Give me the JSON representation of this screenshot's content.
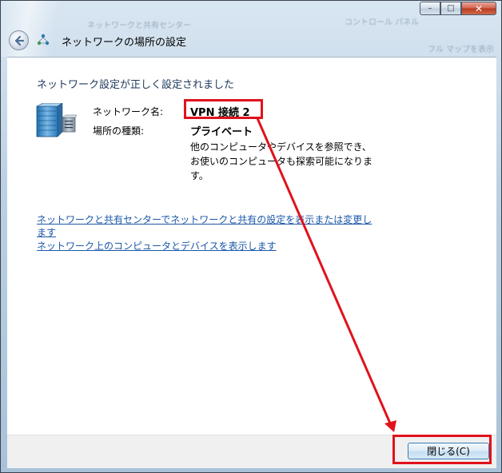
{
  "window": {
    "title_blur_1": "ネットワークと共有センター",
    "title_blur_2": "コントロール パネル",
    "title_blur_3": "フル マップを表示",
    "nav_title": "ネットワークの場所の設定",
    "controls": {
      "minimize": "–",
      "maximize": "□",
      "close": "✕"
    }
  },
  "content": {
    "heading": "ネットワーク設定が正しく設定されました",
    "network_name_label": "ネットワーク名:",
    "network_name_value": "VPN 接続 2",
    "location_type_label": "場所の種類:",
    "location_type_value": "プライベート",
    "description": "他のコンピュータやデバイスを参照でき、お使いのコンピュータも探索可能になります。",
    "link_sharing_line1": "ネットワークと共有センターでネットワークと共有の設定を表示または変更し",
    "link_sharing_line2": "ます",
    "link_computers": "ネットワーク上のコンピュータとデバイスを表示します"
  },
  "footer": {
    "close_label": "閉じる(C)"
  },
  "colors": {
    "annotation": "#e0121b",
    "link": "#1a57a8",
    "heading": "#1e395b"
  },
  "icons": [
    "back-arrow-icon",
    "network-location-icon",
    "server-network-icon",
    "minimize-icon",
    "maximize-icon",
    "close-icon"
  ]
}
